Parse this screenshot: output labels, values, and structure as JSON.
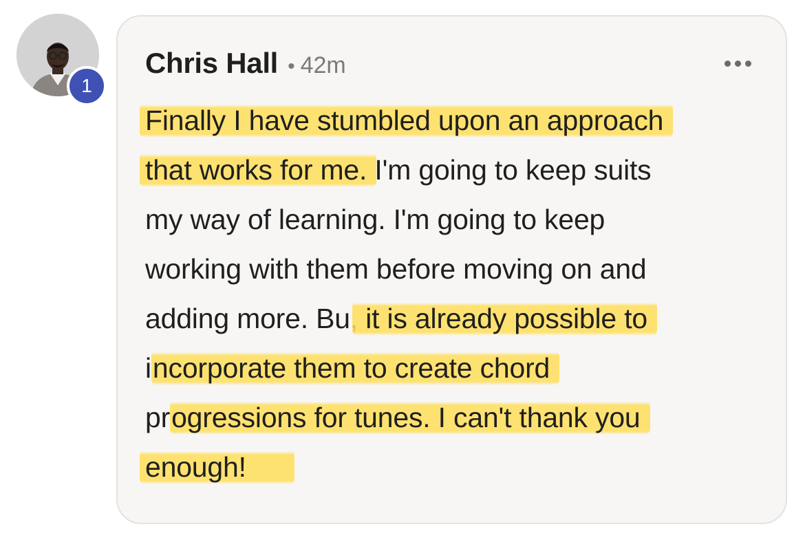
{
  "comment": {
    "author": "Chris Hall",
    "separator": "•",
    "time": "42m",
    "badge_count": "1",
    "menu_icon": "more-horizontal-icon",
    "highlight_color": "#ffde5a",
    "lines": [
      {
        "plain_before": "",
        "highlight": "Finally I have stumbled upon an approach",
        "plain_after": ""
      },
      {
        "plain_before": "",
        "highlight": "that works for me.",
        "plain_after": " I'm going to keep suits"
      },
      {
        "plain_before": "my way of learning. I'm going to keep",
        "highlight": "",
        "plain_after": ""
      },
      {
        "plain_before": "working with them before moving on and",
        "highlight": "",
        "plain_after": ""
      },
      {
        "plain_before": "adding more. Bu,",
        "highlight": " it is already possible to",
        "plain_after": ""
      },
      {
        "plain_before": "i",
        "highlight": "ncorporate them to create chord",
        "plain_after": ""
      },
      {
        "plain_before": "pr",
        "highlight": "ogressions for tunes. I can't thank you",
        "plain_after": ""
      },
      {
        "plain_before": "",
        "highlight": "enough!",
        "plain_after": ""
      }
    ]
  }
}
